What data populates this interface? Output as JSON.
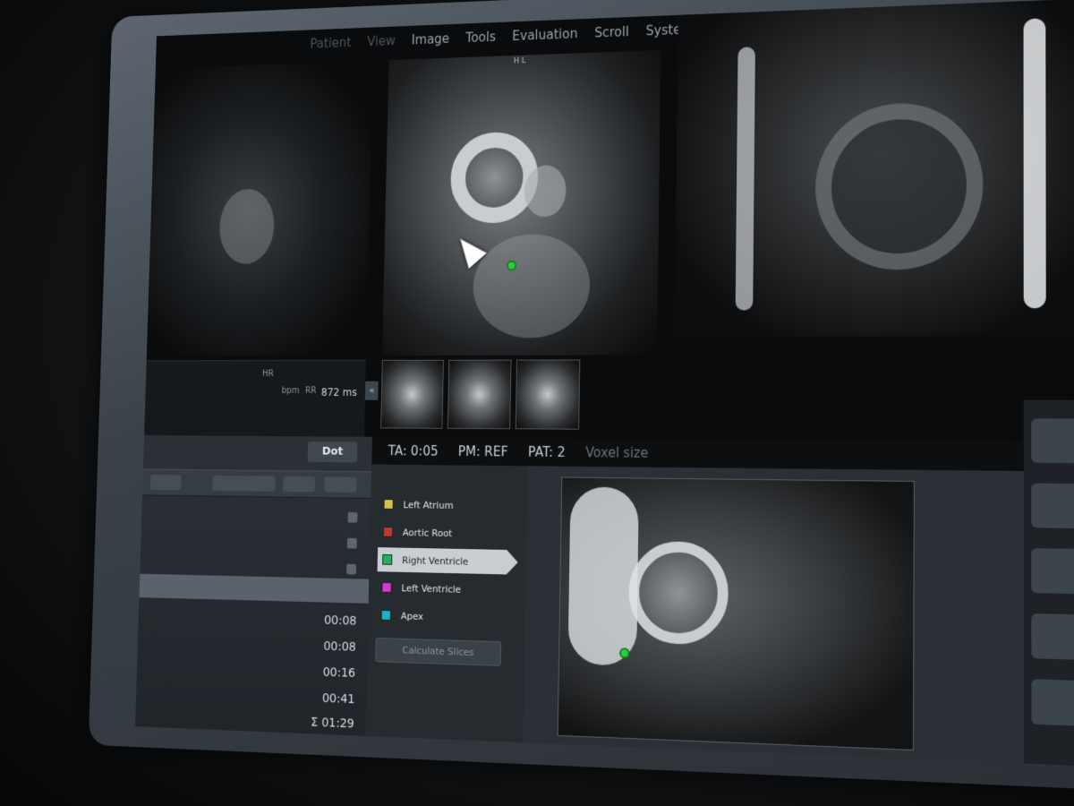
{
  "menu": {
    "items": [
      "Image",
      "Tools",
      "Evaluation",
      "Scroll",
      "System"
    ],
    "dim_items": [
      "Patient",
      "View"
    ]
  },
  "viewport": {
    "hl_label": "H L"
  },
  "ecg": {
    "hr_label": "HR",
    "bpm_unit": "bpm",
    "rr_label": "RR",
    "rr_value": "872 ms"
  },
  "status": {
    "ta": "TA: 0:05",
    "pm": "PM: REF",
    "pat": "PAT: 2",
    "voxel": "Voxel size"
  },
  "protocol": {
    "dot_label": "Dot",
    "selected_index": 3,
    "timers": [
      "00:08",
      "00:08",
      "00:16",
      "00:41"
    ],
    "total": "Σ 01:29"
  },
  "structures": {
    "items": [
      {
        "label": "Left Atrium",
        "color": "#d4c24a",
        "checked": true
      },
      {
        "label": "Aortic Root",
        "color": "#c0392b",
        "checked": true
      },
      {
        "label": "Right Ventricle",
        "color": "#27ae60",
        "checked": true,
        "active": true
      },
      {
        "label": "Left Ventricle",
        "color": "#d63ad1",
        "checked": false
      },
      {
        "label": "Apex",
        "color": "#17b3c4",
        "checked": false
      }
    ],
    "calculate_label": "Calculate Slices"
  }
}
